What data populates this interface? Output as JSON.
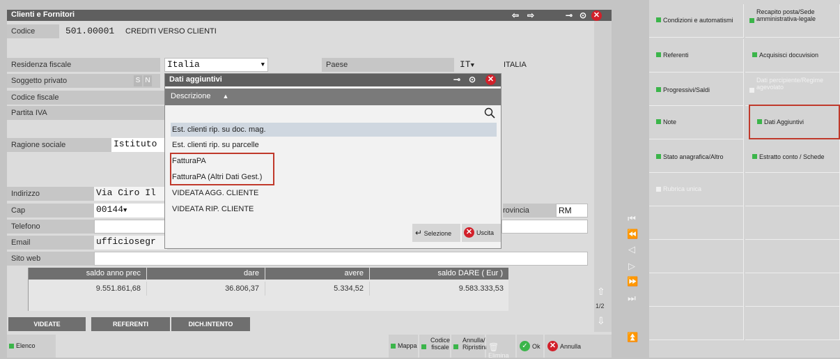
{
  "window": {
    "title": "Clienti e Fornitori",
    "page_indicator": "1/2"
  },
  "fields": {
    "codice_label": "Codice",
    "codice_value": "501.00001",
    "codice_desc": "CREDITI VERSO CLIENTI",
    "residenza_label": "Residenza fiscale",
    "residenza_value": "Italia",
    "paese_label": "Paese",
    "paese_value": "IT",
    "paese_desc": "ITALIA",
    "soggetto_label": "Soggetto privato",
    "sn_s": "S",
    "sn_n": "N",
    "codfisc_label": "Codice fiscale",
    "piva_label": "Partita IVA",
    "ragione_label": "Ragione sociale",
    "ragione_value": "Istituto",
    "indirizzo_label": "Indirizzo",
    "indirizzo_value": "Via Ciro Il",
    "cap_label": "Cap",
    "cap_value": "00144",
    "provincia_label": "rovincia",
    "provincia_value": "RM",
    "telefono_label": "Telefono",
    "email_label": "Email",
    "email_value": "ufficiosegr",
    "sitoweb_label": "Sito web"
  },
  "table": {
    "headers": [
      "saldo anno prec",
      "dare",
      "avere",
      "saldo DARE ( Eur )"
    ],
    "row": [
      "9.551.861,68",
      "36.806,37",
      "5.334,52",
      "9.583.333,53"
    ]
  },
  "buttons": {
    "videate": "VIDEATE",
    "referenti": "REFERENTI",
    "dich_intento": "DICH.INTENTO",
    "elenco": "Elenco",
    "mappa": "Mappa",
    "codice_fiscale_1": "Codice",
    "codice_fiscale_2": "fiscale",
    "annulla_ripristina_1": "Annulla/",
    "annulla_ripristina_2": "Ripristina",
    "elimina": "Elimina",
    "ok": "Ok",
    "annulla": "Annulla"
  },
  "dialog": {
    "title": "Dati aggiuntivi",
    "column_header": "Descrizione",
    "items": [
      "Est. clienti rip. su doc. mag.",
      "Est. clienti rip. su parcelle",
      "FatturaPA",
      "FatturaPA (Altri Dati Gest.)",
      "VIDEATA AGG. CLIENTE",
      "VIDEATA RIP. CLIENTE"
    ],
    "selezione": "Selezione",
    "uscita": "Uscita"
  },
  "right_panel": {
    "items": [
      {
        "label": "Condizioni e automatismi",
        "enabled": true
      },
      {
        "label": "Recapito posta/Sede amministrativa-legale",
        "enabled": true
      },
      {
        "label": "Referenti",
        "enabled": true
      },
      {
        "label": "Acquisisci docuvision",
        "enabled": true
      },
      {
        "label": "Progressivi/Saldi",
        "enabled": true
      },
      {
        "label": "Dati percipiente/Regime agevolato",
        "enabled": false
      },
      {
        "label": "Note",
        "enabled": true
      },
      {
        "label": "Dati Aggiuntivi",
        "enabled": true
      },
      {
        "label": "Stato anagrafica/Altro",
        "enabled": true
      },
      {
        "label": "Estratto conto / Schede",
        "enabled": true
      },
      {
        "label": "Rubrica unica",
        "enabled": false
      }
    ]
  },
  "colors": {
    "accent_green": "#3bb54a",
    "close_red": "#d2202a",
    "highlight_red": "#c0392b"
  }
}
